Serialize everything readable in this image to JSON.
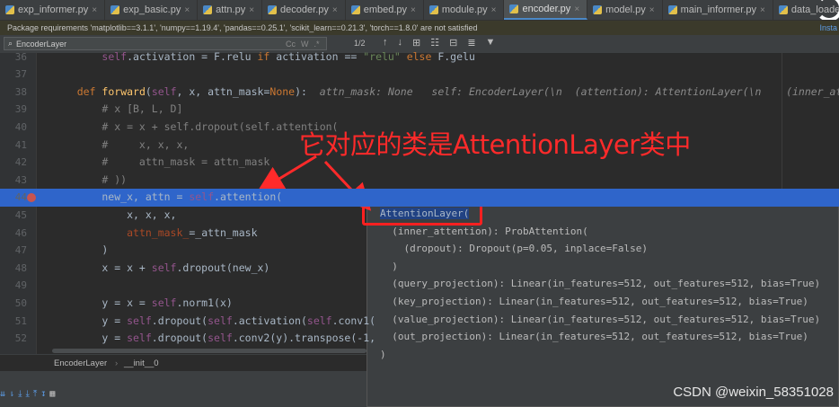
{
  "tabs": [
    {
      "label": "exp_informer.py",
      "active": false
    },
    {
      "label": "exp_basic.py",
      "active": false
    },
    {
      "label": "attn.py",
      "active": false
    },
    {
      "label": "decoder.py",
      "active": false
    },
    {
      "label": "embed.py",
      "active": false
    },
    {
      "label": "module.py",
      "active": false
    },
    {
      "label": "encoder.py",
      "active": true
    },
    {
      "label": "model.py",
      "active": false
    },
    {
      "label": "main_informer.py",
      "active": false
    },
    {
      "label": "data_loader.py",
      "active": false
    }
  ],
  "notice": {
    "text": "Package requirements 'matplotlib==3.1.1', 'numpy==1.19.4', 'pandas==0.25.1', 'scikit_learn==0.21.3', 'torch==1.8.0' are not satisfied",
    "action": "Insta"
  },
  "find": {
    "query": "EncoderLayer",
    "options": [
      "Cc",
      "W",
      ".*"
    ],
    "match_count": "1/2"
  },
  "code_lines": [
    {
      "n": "36",
      "text": "        self.activation = F.relu if activation == \"relu\" else F.gelu"
    },
    {
      "n": "37",
      "text": ""
    },
    {
      "n": "38",
      "text": "    def forward(self, x, attn_mask=None):  attn_mask: None   self: EncoderLayer(\\n  (attention): AttentionLayer(\\n    (inner_atte"
    },
    {
      "n": "39",
      "text": "        # x [B, L, D]"
    },
    {
      "n": "40",
      "text": "        # x = x + self.dropout(self.attention("
    },
    {
      "n": "41",
      "text": "        #     x, x, x,"
    },
    {
      "n": "42",
      "text": "        #     attn_mask = attn_mask"
    },
    {
      "n": "43",
      "text": "        # ))"
    },
    {
      "n": "44",
      "text": "        new_x, attn = self.attention("
    },
    {
      "n": "45",
      "text": "            x, x, x,"
    },
    {
      "n": "46",
      "text": "            attn_mask_=_attn_mask"
    },
    {
      "n": "47",
      "text": "        )"
    },
    {
      "n": "48",
      "text": "        x = x + self.dropout(new_x)"
    },
    {
      "n": "49",
      "text": ""
    },
    {
      "n": "50",
      "text": "        y = x = self.norm1(x)"
    },
    {
      "n": "51",
      "text": "        y = self.dropout(self.activation(self.conv1("
    },
    {
      "n": "52",
      "text": "        y = self.dropout(self.conv2(y).transpose(-1,"
    }
  ],
  "popup_lines": [
    "AttentionLayer(",
    "  (inner_attention): ProbAttention(",
    "    (dropout): Dropout(p=0.05, inplace=False)",
    "  )",
    "  (query_projection): Linear(in_features=512, out_features=512, bias=True)",
    "  (key_projection): Linear(in_features=512, out_features=512, bias=True)",
    "  (value_projection): Linear(in_features=512, out_features=512, bias=True)",
    "  (out_projection): Linear(in_features=512, out_features=512, bias=True)",
    ")"
  ],
  "breadcrumb": {
    "class": "EncoderLayer",
    "method": "__init__0"
  },
  "annotation": "它对应的类是AttentionLayer类中",
  "watermark": "CSDN @weixin_58351028",
  "colors": {
    "annotation": "#ff2a2a",
    "highlight": "#2f65ca",
    "breakpoint": "#c75450"
  }
}
